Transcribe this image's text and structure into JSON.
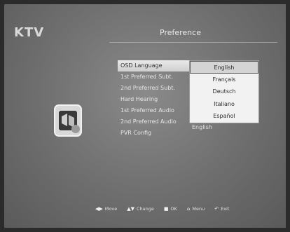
{
  "logo": "KTV",
  "window_title": "Preference",
  "menu_items": [
    "OSD Language",
    "1st Preferred Subt.",
    "2nd Preferred Subt.",
    "Hard Hearing",
    "1st Preferred Audio",
    "2nd Preferred Audio",
    "PVR Config"
  ],
  "selected_index": 0,
  "audio2_value": "English",
  "language_options": [
    "English",
    "Français",
    "Deutsch",
    "Italiano",
    "Español"
  ],
  "active_option_index": 0,
  "footer_hints": [
    {
      "icon": "move-arrows-icon",
      "label": "Move"
    },
    {
      "icon": "change-arrows-icon",
      "label": "Change"
    },
    {
      "icon": "ok-icon",
      "label": "OK"
    },
    {
      "icon": "menu-icon",
      "label": "Menu"
    },
    {
      "icon": "exit-icon",
      "label": "Exit"
    }
  ],
  "colors": {
    "screen_bg": "#6e6e6e",
    "highlight": "#e9e9e9",
    "dropdown_bg": "#f2f2f2"
  }
}
